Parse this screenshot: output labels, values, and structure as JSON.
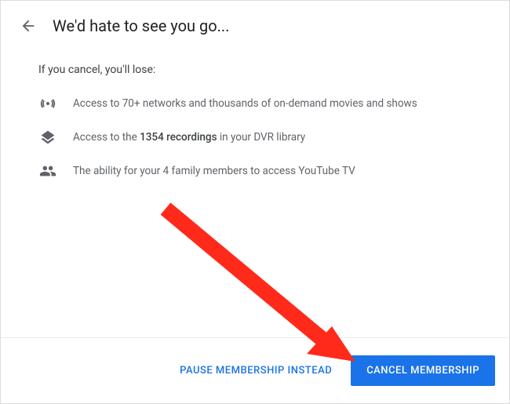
{
  "header": {
    "title": "We'd hate to see you go..."
  },
  "content": {
    "subtitle": "If you cancel, you'll lose:",
    "benefits": {
      "networks": "Access to 70+ networks and thousands of on-demand movies and shows",
      "recordings_prefix": "Access to the ",
      "recordings_count": "1354 recordings",
      "recordings_suffix": " in your DVR library",
      "family": "The ability for your 4 family members to access YouTube TV"
    }
  },
  "footer": {
    "pause_label": "PAUSE MEMBERSHIP INSTEAD",
    "cancel_label": "CANCEL MEMBERSHIP"
  }
}
